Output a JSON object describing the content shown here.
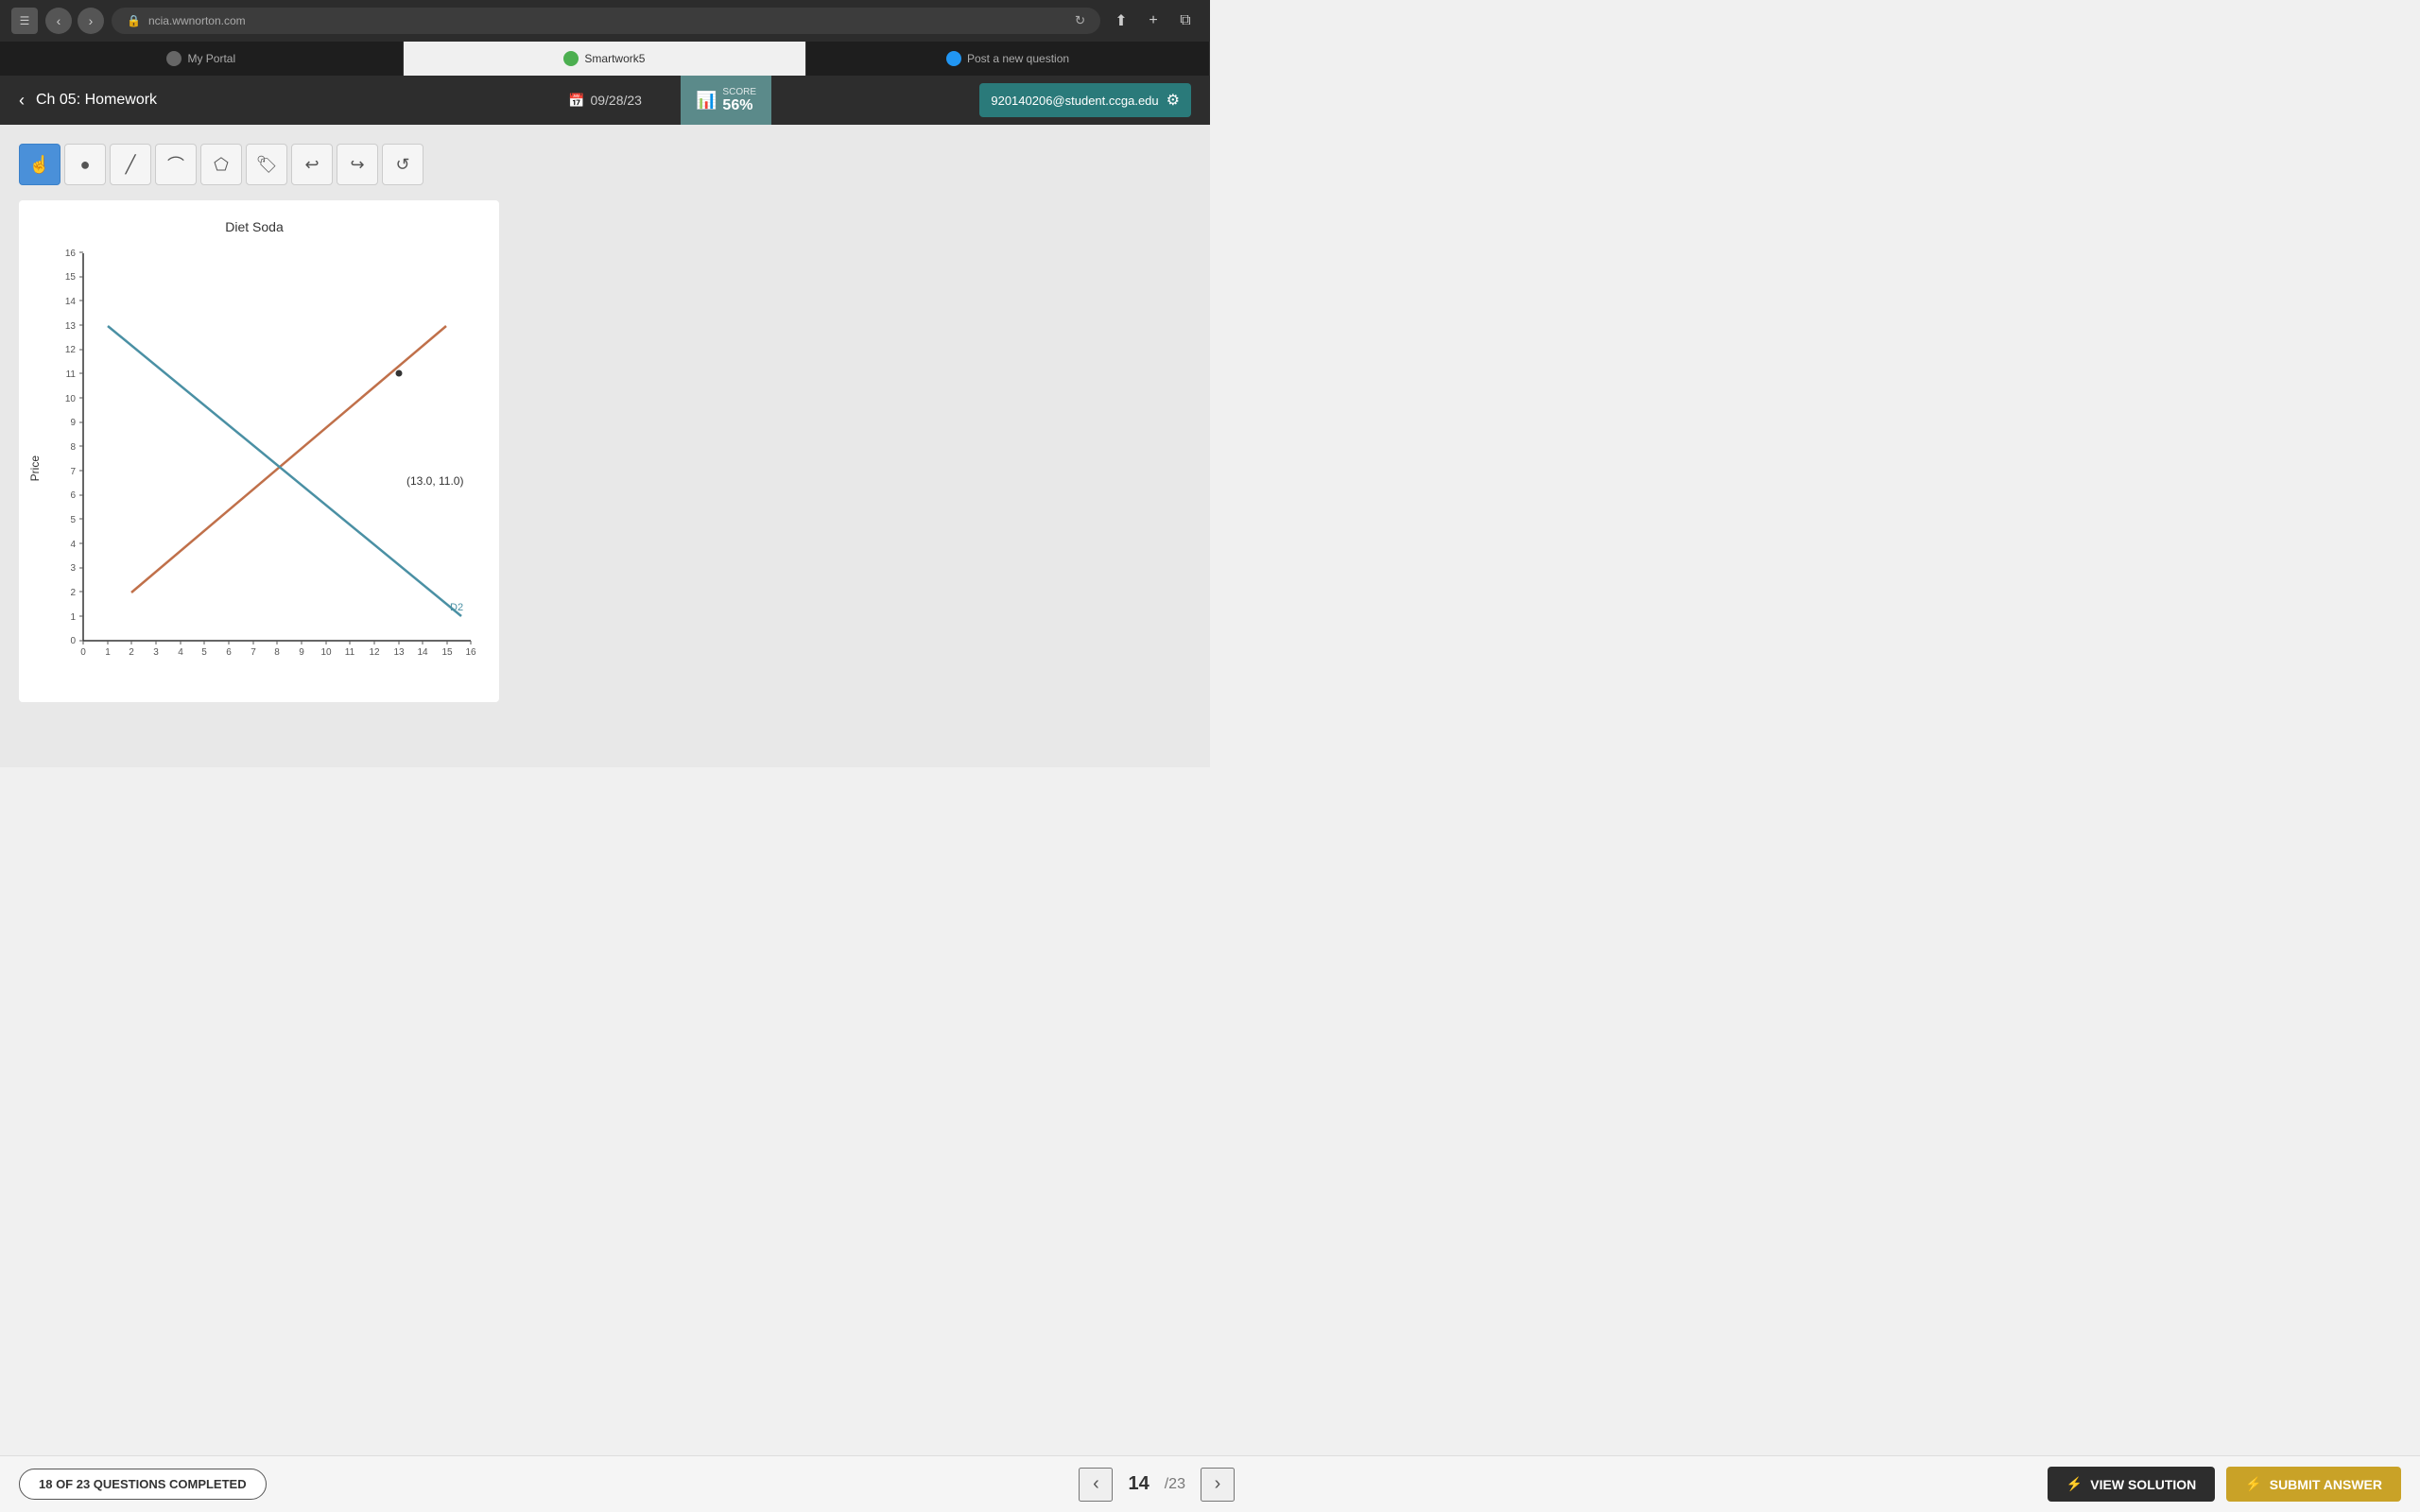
{
  "browser": {
    "url": "ncia.wwnorton.com",
    "tabs": [
      {
        "label": "My Portal",
        "active": false,
        "icon": "portal"
      },
      {
        "label": "Smartwork5",
        "active": true,
        "icon": "green"
      },
      {
        "label": "Post a new question",
        "active": false,
        "icon": "blue"
      }
    ]
  },
  "header": {
    "back_label": "‹",
    "chapter_title": "Ch 05: Homework",
    "date_icon": "📅",
    "date": "09/28/23",
    "score_label": "SCORE",
    "score_value": "56%",
    "user_email": "920140206@student.ccga.edu"
  },
  "toolbar": {
    "tools": [
      {
        "name": "select",
        "icon": "☝",
        "active": true
      },
      {
        "name": "dot",
        "icon": "●",
        "active": false
      },
      {
        "name": "line",
        "icon": "╱",
        "active": false
      },
      {
        "name": "curve",
        "icon": "⌒",
        "active": false
      },
      {
        "name": "polygon",
        "icon": "⬠",
        "active": false
      },
      {
        "name": "tag",
        "icon": "🏷",
        "active": false
      },
      {
        "name": "undo",
        "icon": "↩",
        "active": false
      },
      {
        "name": "redo",
        "icon": "↪",
        "active": false
      },
      {
        "name": "reset",
        "icon": "↺",
        "active": false
      }
    ]
  },
  "chart": {
    "title": "Diet Soda",
    "y_axis_label": "Price",
    "x_min": 0,
    "x_max": 16,
    "y_min": 0,
    "y_max": 16,
    "annotation": "(13.0, 11.0)",
    "supply_line_label": "",
    "demand2_label": "D2",
    "x_ticks": [
      "0",
      "1",
      "2",
      "3",
      "4",
      "5",
      "6",
      "7",
      "8",
      "9",
      "10",
      "11",
      "12",
      "13",
      "14",
      "15",
      "16"
    ],
    "y_ticks": [
      "0",
      "1",
      "2",
      "3",
      "4",
      "5",
      "6",
      "7",
      "8",
      "9",
      "10",
      "11",
      "12",
      "13",
      "14",
      "15",
      "16"
    ]
  },
  "bottom_bar": {
    "progress_text": "18 OF 23 QUESTIONS COMPLETED",
    "question_number": "14",
    "question_total": "/23",
    "prev_icon": "‹",
    "next_icon": "›",
    "view_solution_label": "VIEW SOLUTION",
    "submit_answer_label": "SUBMIT ANSWER",
    "lightning_icon": "⚡"
  }
}
